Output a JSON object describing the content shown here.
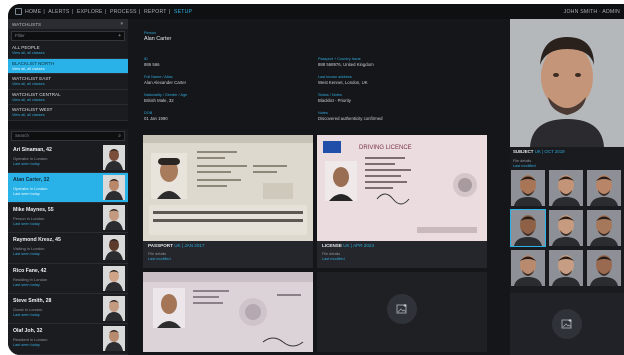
{
  "topbar": {
    "nav": [
      "HOME",
      "ALERTS",
      "EXPLORE",
      "PROCESS",
      "REPORT",
      "SETUP"
    ],
    "active_nav": "SETUP",
    "user": "JOHN SMITH · ADMIN"
  },
  "sidebar": {
    "section_title": "WATCHLISTS",
    "search_placeholder": "Filter",
    "watchlists": [
      {
        "title": "ALL PEOPLE",
        "sub": "View all, all classes",
        "selected": false
      },
      {
        "title": "BLACKLIST NORTH",
        "sub": "View all, all classes",
        "selected": true
      },
      {
        "title": "WATCHLIST EAST",
        "sub": "View all, all classes",
        "selected": false
      },
      {
        "title": "WATCHLIST CENTRAL",
        "sub": "View all, all classes",
        "selected": false
      },
      {
        "title": "WATCHLIST WEST",
        "sub": "View all, all classes",
        "selected": false
      }
    ],
    "people_search_placeholder": "Search",
    "people": [
      {
        "name": "Ari Sinaman, 42",
        "location": "Operator in London",
        "sub": "Last seen today",
        "selected": false
      },
      {
        "name": "Alan Carter, 32",
        "location": "Operator in London",
        "sub": "Last seen today",
        "selected": true
      },
      {
        "name": "Mike Maynes, 55",
        "location": "Person in London",
        "sub": "Last seen today",
        "selected": false
      },
      {
        "name": "Raymond Kresz, 45",
        "location": "Visiting in London",
        "sub": "Last seen today",
        "selected": false
      },
      {
        "name": "Rico Fane, 42",
        "location": "Residing in London",
        "sub": "Last seen today",
        "selected": false
      },
      {
        "name": "Steve Smith, 28",
        "location": "Guest in London",
        "sub": "Last seen today",
        "selected": false
      },
      {
        "name": "Olaf Joh, 32",
        "location": "Resident in London",
        "sub": "Last seen today",
        "selected": false
      }
    ]
  },
  "profile": {
    "fields": [
      {
        "key": "Person",
        "value": "Alan Carter"
      },
      {
        "key": "ID",
        "value": "886 566"
      },
      {
        "key": "Passport + Country Issue",
        "value": "888 568976, United Kingdom"
      },
      {
        "key": "Full Name / Alias",
        "value": "Alan Alexander Carter"
      },
      {
        "key": "Last known address",
        "value": "West Kennet, London, UK"
      },
      {
        "key": "Nationality / Gender / Age",
        "value": "British Male, 32"
      },
      {
        "key": "Status / Notes",
        "value": "Blacklist - Priority"
      },
      {
        "key": "DOB",
        "value": "01 Jan 1990"
      },
      {
        "key": "Notes",
        "value": "Discovered authenticity confirmed"
      }
    ],
    "documents": [
      {
        "type": "PASSPORT",
        "date": "UK | JAN 2017",
        "line1": "File details",
        "line2": "Last modified"
      },
      {
        "type": "LICENSE",
        "date": "UK | APR 2023",
        "line1": "File details",
        "line2": "Last modified"
      },
      {
        "type": "",
        "date": "",
        "line1": "",
        "line2": ""
      },
      {
        "type": "",
        "date": "",
        "line1": "",
        "line2": ""
      }
    ],
    "add_icon": "add-image-icon"
  },
  "right_panel": {
    "label": "SUBJECT",
    "date": "UK | OCT 2019",
    "line1": "File details",
    "line2": "Last modified"
  },
  "colors": {
    "accent": "#29b2e8",
    "background": "#17181b",
    "panel": "#24262b"
  }
}
